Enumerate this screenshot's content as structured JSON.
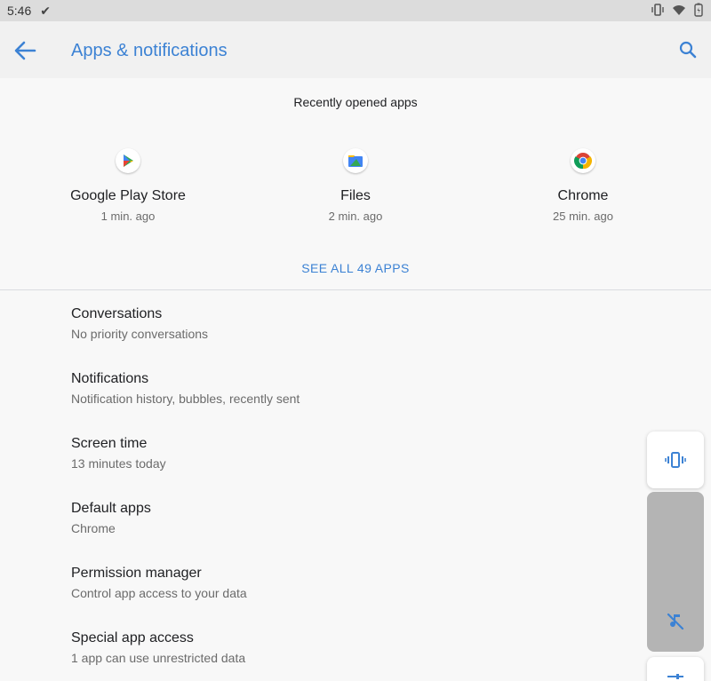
{
  "status_bar": {
    "time": "5:46"
  },
  "app_bar": {
    "title": "Apps & notifications"
  },
  "recent": {
    "header": "Recently opened apps",
    "apps": [
      {
        "name": "Google Play Store",
        "time": "1 min. ago",
        "icon": "play-store-icon"
      },
      {
        "name": "Files",
        "time": "2 min. ago",
        "icon": "files-icon"
      },
      {
        "name": "Chrome",
        "time": "25 min. ago",
        "icon": "chrome-icon"
      }
    ],
    "see_all": "SEE ALL 49 APPS"
  },
  "settings": [
    {
      "title": "Conversations",
      "subtitle": "No priority conversations"
    },
    {
      "title": "Notifications",
      "subtitle": "Notification history, bubbles, recently sent"
    },
    {
      "title": "Screen time",
      "subtitle": "13 minutes today"
    },
    {
      "title": "Default apps",
      "subtitle": "Chrome"
    },
    {
      "title": "Permission manager",
      "subtitle": "Control app access to your data"
    },
    {
      "title": "Special app access",
      "subtitle": "1 app can use unrestricted data"
    }
  ],
  "colors": {
    "accent": "#3c82d4",
    "status_bar": "#dcdcdc",
    "app_bar": "#f1f1f1",
    "background": "#f8f8f8"
  }
}
